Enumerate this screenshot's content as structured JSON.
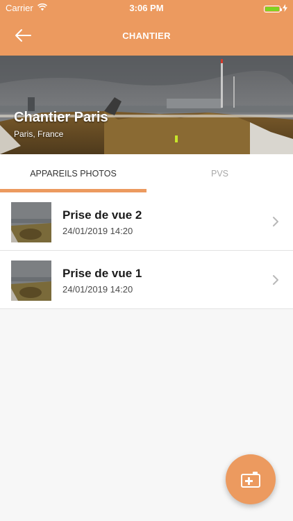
{
  "status_bar": {
    "carrier": "Carrier",
    "time": "3:06 PM",
    "battery_level": 1.0
  },
  "header": {
    "title": "CHANTIER",
    "back_icon": "arrow-left-icon"
  },
  "site": {
    "name": "Chantier Paris",
    "location": "Paris, France"
  },
  "tabs": [
    {
      "label": "APPAREILS PHOTOS",
      "active": true
    },
    {
      "label": "PVS",
      "active": false
    }
  ],
  "photos": [
    {
      "title": "Prise de vue 2",
      "date": "24/01/2019 14:20"
    },
    {
      "title": "Prise de vue 1",
      "date": "24/01/2019 14:20"
    }
  ],
  "fab": {
    "icon": "add-camera-icon"
  },
  "colors": {
    "accent": "#ec9a5f",
    "battery": "#7ed321",
    "tab_active_text": "#333333",
    "tab_inactive_text": "#a8a8a8"
  }
}
